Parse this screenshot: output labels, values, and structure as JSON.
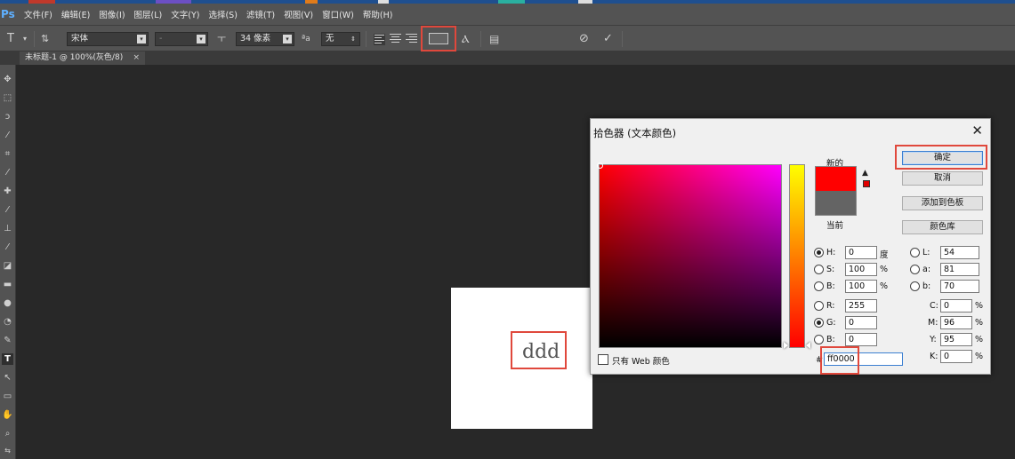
{
  "menubar": {
    "logo": "Ps",
    "items": [
      "文件(F)",
      "编辑(E)",
      "图像(I)",
      "图层(L)",
      "文字(Y)",
      "选择(S)",
      "滤镜(T)",
      "视图(V)",
      "窗口(W)",
      "帮助(H)"
    ]
  },
  "options": {
    "tool_glyph": "T",
    "font_family": "宋体",
    "font_style": "-",
    "font_size": "34 像素",
    "aa_label": "ªa",
    "antialias": "无",
    "text_color_hex": "#646464"
  },
  "document": {
    "tab_title": "未标题-1 @ 100%(灰色/8)",
    "tab_close": "×",
    "canvas_text": "ddd"
  },
  "picker": {
    "title": "拾色器 (文本颜色)",
    "close": "✕",
    "label_new": "新的",
    "label_current": "当前",
    "new_color": "#ff0000",
    "current_color": "#646464",
    "buttons": {
      "ok": "确定",
      "cancel": "取消",
      "add_swatch": "添加到色板",
      "libraries": "颜色库"
    },
    "hsb": {
      "h_label": "H:",
      "h": "0",
      "h_unit": "度",
      "s_label": "S:",
      "s": "100",
      "s_unit": "%",
      "b_label": "B:",
      "b": "100",
      "b_unit": "%"
    },
    "rgb": {
      "r_label": "R:",
      "r": "255",
      "g_label": "G:",
      "g": "0",
      "b_label": "B:",
      "b": "0"
    },
    "lab": {
      "l_label": "L:",
      "l": "54",
      "a_label": "a:",
      "a": "81",
      "b_label": "b:",
      "b": "70"
    },
    "cmyk": {
      "c_label": "C:",
      "c": "0",
      "c_unit": "%",
      "m_label": "M:",
      "m": "96",
      "m_unit": "%",
      "y_label": "Y:",
      "y": "95",
      "y_unit": "%",
      "k_label": "K:",
      "k": "0",
      "k_unit": "%"
    },
    "hex_label": "#",
    "hex": "ff0000",
    "web_only": "只有 Web 颜色"
  }
}
